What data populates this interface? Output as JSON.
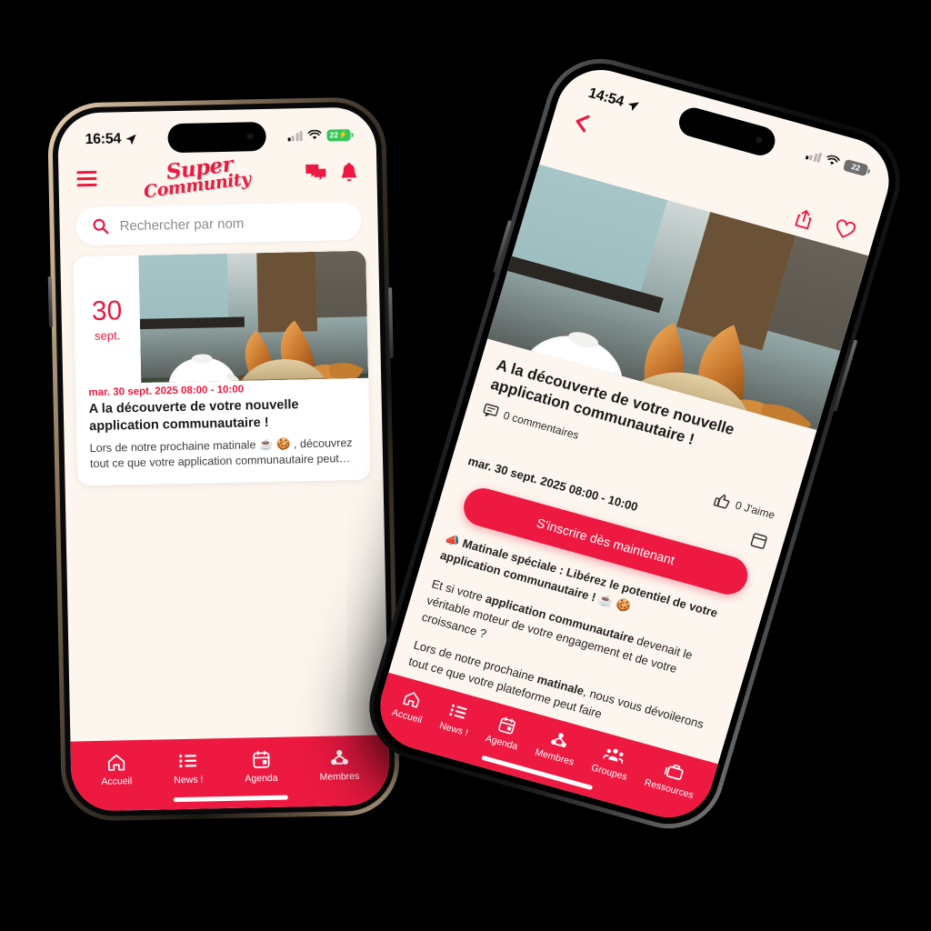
{
  "brand": {
    "name_line1": "Super",
    "name_line2": "Community",
    "accent_red": "#ED1941",
    "background_cream": "#FCF6EF",
    "logo_shadow_teal": "#BFE3DC"
  },
  "phone_left": {
    "status_bar": {
      "time": "16:54",
      "location_icon": "location-arrow-icon",
      "signal_icon": "cellular-signal-icon",
      "wifi_icon": "wifi-icon",
      "battery_percent": "22",
      "battery_charging": true
    },
    "header": {
      "menu_icon": "hamburger-menu-icon",
      "messages_icon": "chat-bubble-icon",
      "notifications_icon": "bell-icon"
    },
    "search": {
      "icon": "search-icon",
      "placeholder": "Rechercher par nom",
      "value": ""
    },
    "event_card": {
      "day": "30",
      "month": "sept.",
      "image_alt": "bakery-croissants-photo",
      "date_line": "mar. 30 sept. 2025 08:00 - 10:00",
      "title": "A la découverte de votre nouvelle application communautaire !",
      "excerpt": "Lors de notre prochaine matinale ☕ 🍪 , découvrez tout ce que votre application communautaire peut…"
    },
    "bottom_nav": [
      {
        "label": "Accueil",
        "icon": "home-icon"
      },
      {
        "label": "News !",
        "icon": "list-icon"
      },
      {
        "label": "Agenda",
        "icon": "calendar-icon"
      },
      {
        "label": "Membres",
        "icon": "members-icon"
      }
    ]
  },
  "phone_right": {
    "status_bar": {
      "time": "14:54",
      "location_icon": "location-arrow-icon",
      "signal_icon": "cellular-signal-icon",
      "wifi_icon": "wifi-icon",
      "battery_percent": "22",
      "battery_charging": false
    },
    "nav": {
      "back_icon": "chevron-left-icon",
      "share_icon": "share-icon",
      "favorite_icon": "heart-icon"
    },
    "detail": {
      "image_alt": "bakery-croissants-photo",
      "title": "A la découverte de votre nouvelle application communautaire !",
      "comments_icon": "comment-icon",
      "comments_label": "0 commentaires",
      "likes_icon": "thumbs-up-icon",
      "likes_label": "0 J'aime",
      "date_line": "mar. 30 sept. 2025 08:00 - 10:00",
      "calendar_icon": "calendar-add-icon",
      "cta_label": "S'inscrire dès maintenant",
      "paragraph_1_emoji": "📣",
      "paragraph_1_bold": "Matinale spéciale : Libérez le potentiel de votre application communautaire !",
      "paragraph_1_tail": " ☕ 🍪",
      "paragraph_2_lead": "Et si votre ",
      "paragraph_2_bold": "application communautaire",
      "paragraph_2_tail": " devenait le véritable moteur de votre engagement et de votre croissance ?",
      "paragraph_3_lead": "Lors de notre prochaine ",
      "paragraph_3_bold": "matinale",
      "paragraph_3_tail": ", nous vous dévoilerons tout ce que votre plateforme peut faire"
    },
    "bottom_nav": [
      {
        "label": "Accueil",
        "icon": "home-icon"
      },
      {
        "label": "News !",
        "icon": "list-icon"
      },
      {
        "label": "Agenda",
        "icon": "calendar-icon"
      },
      {
        "label": "Membres",
        "icon": "members-icon"
      },
      {
        "label": "Groupes",
        "icon": "groups-icon"
      },
      {
        "label": "Ressources",
        "icon": "briefcase-icon"
      }
    ]
  }
}
